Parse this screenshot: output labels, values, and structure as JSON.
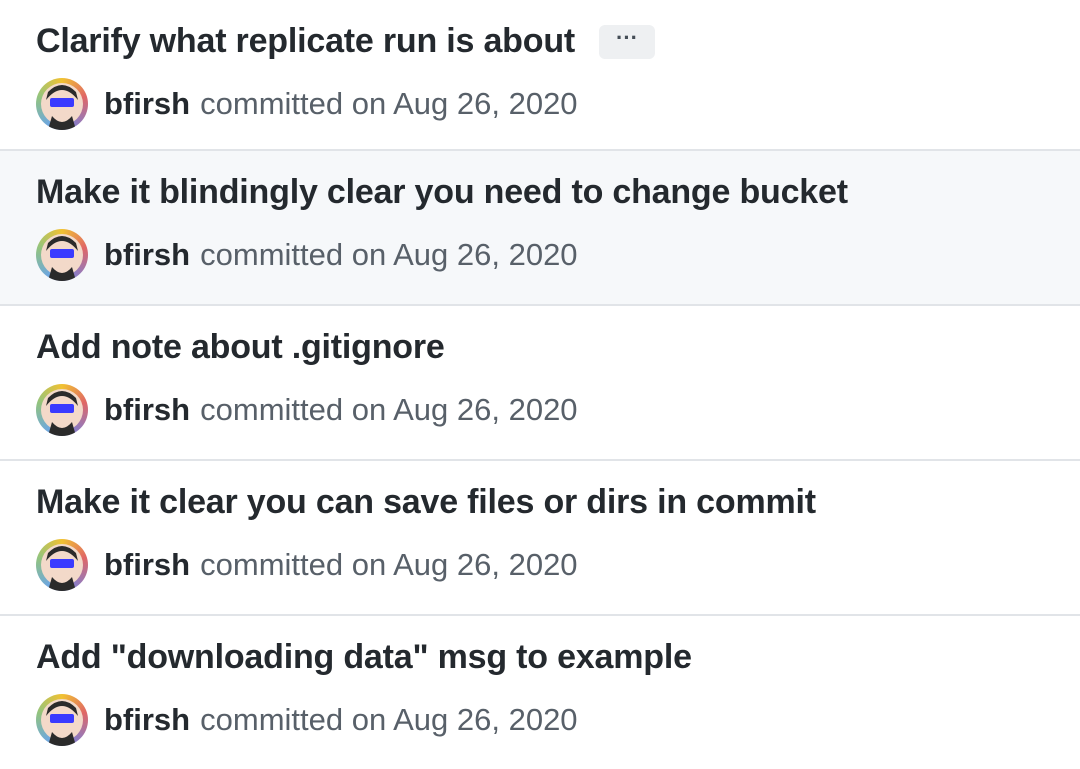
{
  "commits": [
    {
      "title": "Clarify what replicate run is about",
      "more_label": "···",
      "author": "bfirsh",
      "meta": "committed on Aug 26, 2020"
    },
    {
      "title": "Make it blindingly clear you need to change bucket",
      "author": "bfirsh",
      "meta": "committed on Aug 26, 2020"
    },
    {
      "title": "Add note about .gitignore",
      "author": "bfirsh",
      "meta": "committed on Aug 26, 2020"
    },
    {
      "title": "Make it clear you can save files or dirs in commit",
      "author": "bfirsh",
      "meta": "committed on Aug 26, 2020"
    },
    {
      "title": "Add \"downloading data\" msg to example",
      "author": "bfirsh",
      "meta": "committed on Aug 26, 2020"
    }
  ],
  "icons": {
    "avatar": "avatar-icon",
    "more": "ellipsis-icon"
  },
  "colors": {
    "title": "#24292e",
    "meta": "#586069",
    "divider": "#e1e4e8",
    "highlight_row": "#f6f8fa"
  }
}
